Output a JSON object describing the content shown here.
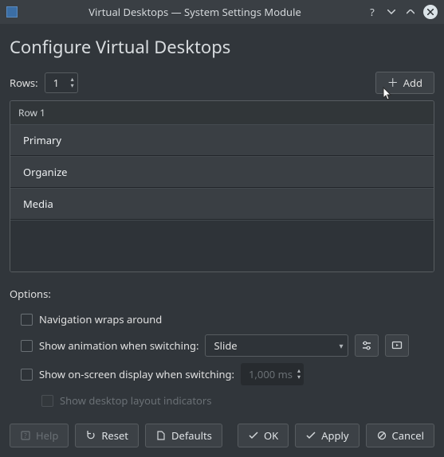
{
  "window": {
    "title": "Virtual Desktops — System Settings Module"
  },
  "page": {
    "heading": "Configure Virtual Desktops"
  },
  "rows": {
    "label": "Rows:",
    "value": "1"
  },
  "add_button": {
    "label": "Add"
  },
  "desktop_list": {
    "row_header": "Row 1",
    "items": [
      {
        "name": "Primary"
      },
      {
        "name": "Organize"
      },
      {
        "name": "Media"
      }
    ]
  },
  "options": {
    "label": "Options:",
    "nav_wrap": "Navigation wraps around",
    "show_anim": "Show animation when switching:",
    "anim_select": "Slide",
    "show_osd": "Show on-screen display when switching:",
    "osd_duration": "1,000 ms",
    "layout_indicators": "Show desktop layout indicators"
  },
  "buttons": {
    "help": "Help",
    "reset": "Reset",
    "defaults": "Defaults",
    "ok": "OK",
    "apply": "Apply",
    "cancel": "Cancel"
  }
}
